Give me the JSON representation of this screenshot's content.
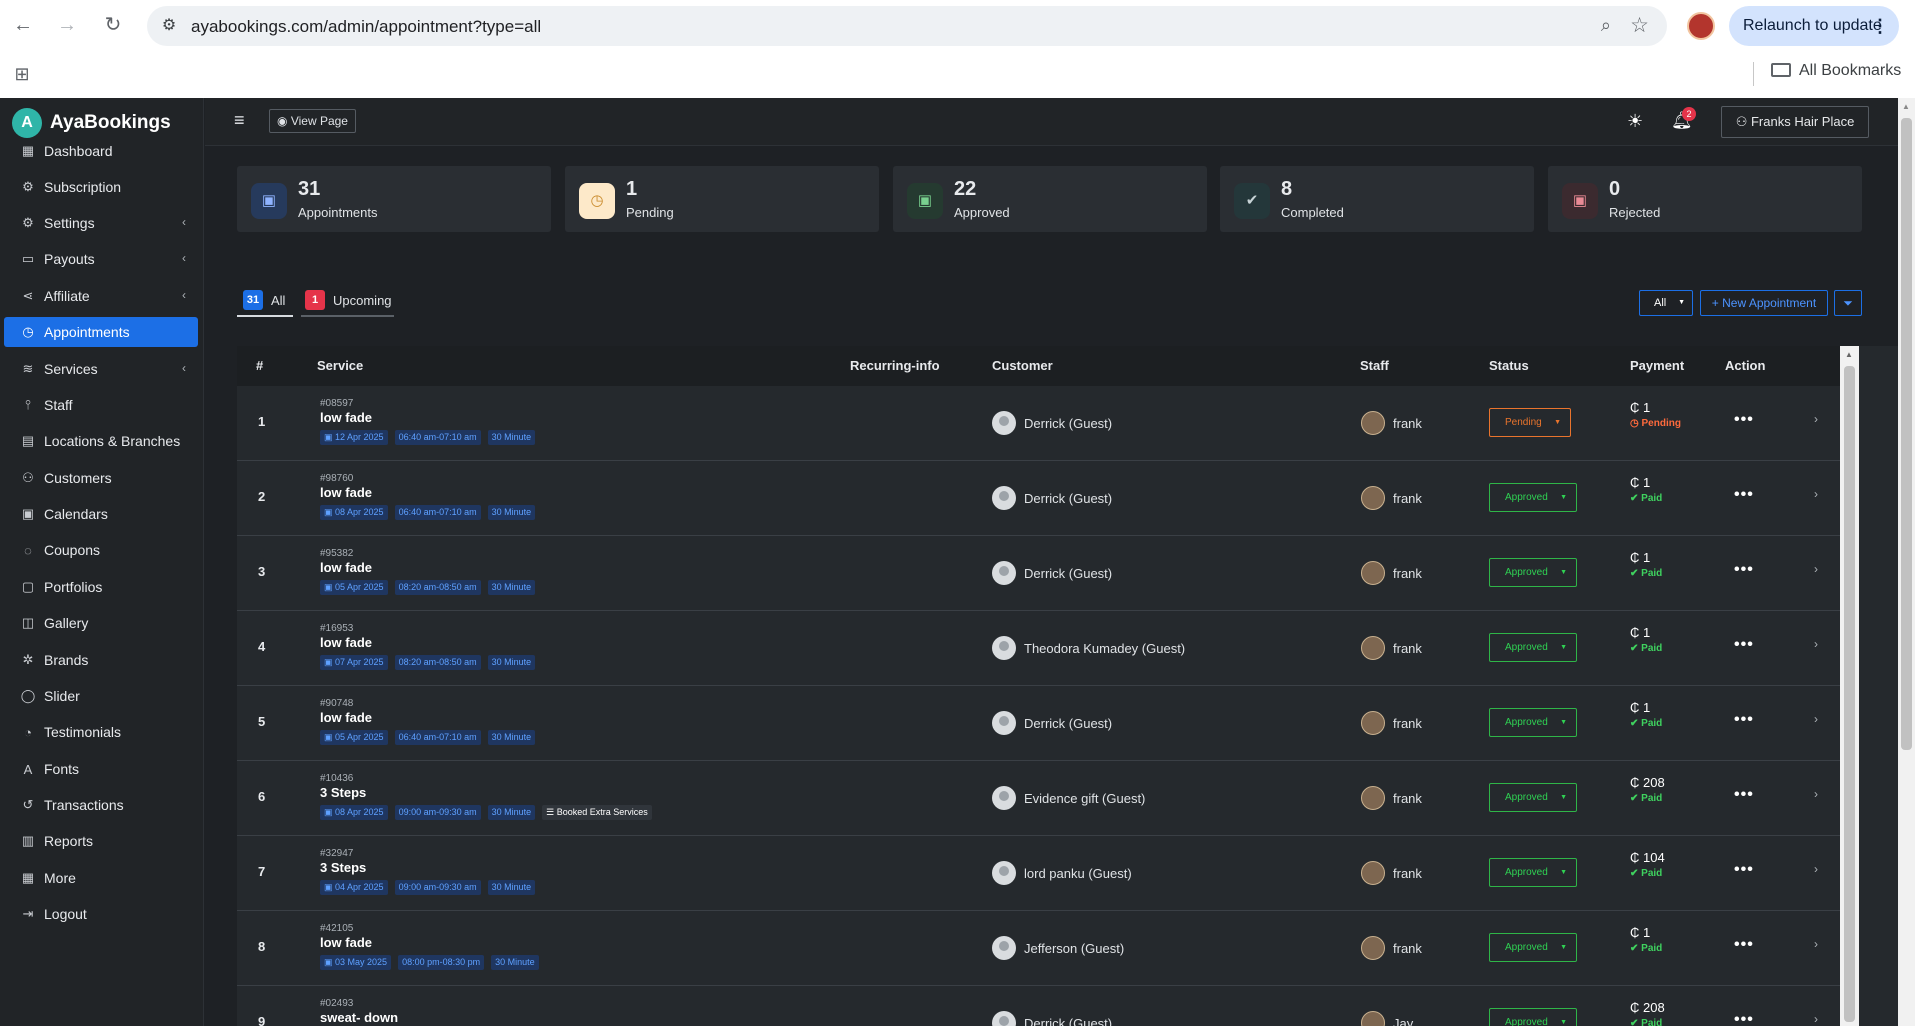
{
  "browser": {
    "url": "ayabookings.com/admin/appointment?type=all",
    "relaunch_label": "Relaunch to update",
    "bookmarks_label": "All Bookmarks"
  },
  "app": {
    "brand_name": "AyaBookings",
    "view_page_label": "View Page",
    "notification_count": "2",
    "user_label": "Franks Hair Place"
  },
  "sidebar": {
    "items": [
      {
        "label": "Dashboard",
        "icon": "grid-icon"
      },
      {
        "label": "Subscription",
        "icon": "gear-icon"
      },
      {
        "label": "Settings",
        "icon": "gear-icon"
      },
      {
        "label": "Payouts",
        "icon": "card-icon"
      },
      {
        "label": "Affiliate",
        "icon": "share-icon"
      },
      {
        "label": "Appointments",
        "icon": "clock-icon"
      },
      {
        "label": "Services",
        "icon": "layers-icon"
      },
      {
        "label": "Staff",
        "icon": "sitemap-icon"
      },
      {
        "label": "Locations & Branches",
        "icon": "building-icon"
      },
      {
        "label": "Customers",
        "icon": "users-icon"
      },
      {
        "label": "Calendars",
        "icon": "calendar-icon"
      },
      {
        "label": "Coupons",
        "icon": "coupon-icon"
      },
      {
        "label": "Portfolios",
        "icon": "portfolio-icon"
      },
      {
        "label": "Gallery",
        "icon": "gallery-icon"
      },
      {
        "label": "Brands",
        "icon": "brand-icon"
      },
      {
        "label": "Slider",
        "icon": "slider-icon"
      },
      {
        "label": "Testimonials",
        "icon": "chat-icon"
      },
      {
        "label": "Fonts",
        "icon": "font-icon"
      },
      {
        "label": "Transactions",
        "icon": "history-icon"
      },
      {
        "label": "Reports",
        "icon": "chart-icon"
      },
      {
        "label": "More",
        "icon": "table-icon"
      },
      {
        "label": "Logout",
        "icon": "logout-icon"
      }
    ]
  },
  "stats": [
    {
      "value": "31",
      "label": "Appointments"
    },
    {
      "value": "1",
      "label": "Pending"
    },
    {
      "value": "22",
      "label": "Approved"
    },
    {
      "value": "8",
      "label": "Completed"
    },
    {
      "value": "0",
      "label": "Rejected"
    }
  ],
  "tabs": [
    {
      "count": "31",
      "label": "All"
    },
    {
      "count": "1",
      "label": "Upcoming"
    }
  ],
  "toolbar": {
    "filter_value": "All",
    "new_appointment_label": "+ New Appointment"
  },
  "table": {
    "headers": [
      "#",
      "Service",
      "Recurring-info",
      "Customer",
      "Staff",
      "Status",
      "Payment",
      "Action"
    ],
    "rows": [
      {
        "num": "1",
        "code": "#08597",
        "service": "low fade",
        "date": "12 Apr 2025",
        "time": "06:40 am-07:10 am",
        "duration": "30 Minute",
        "extra": "",
        "customer": "Derrick (Guest)",
        "staff": "frank",
        "status": "Pending",
        "amount": "₵ 1",
        "pay_status": "Pending"
      },
      {
        "num": "2",
        "code": "#98760",
        "service": "low fade",
        "date": "08 Apr 2025",
        "time": "06:40 am-07:10 am",
        "duration": "30 Minute",
        "extra": "",
        "customer": "Derrick (Guest)",
        "staff": "frank",
        "status": "Approved",
        "amount": "₵ 1",
        "pay_status": "Paid"
      },
      {
        "num": "3",
        "code": "#95382",
        "service": "low fade",
        "date": "05 Apr 2025",
        "time": "08:20 am-08:50 am",
        "duration": "30 Minute",
        "extra": "",
        "customer": "Derrick (Guest)",
        "staff": "frank",
        "status": "Approved",
        "amount": "₵ 1",
        "pay_status": "Paid"
      },
      {
        "num": "4",
        "code": "#16953",
        "service": "low fade",
        "date": "07 Apr 2025",
        "time": "08:20 am-08:50 am",
        "duration": "30 Minute",
        "extra": "",
        "customer": "Theodora Kumadey (Guest)",
        "staff": "frank",
        "status": "Approved",
        "amount": "₵ 1",
        "pay_status": "Paid"
      },
      {
        "num": "5",
        "code": "#90748",
        "service": "low fade",
        "date": "05 Apr 2025",
        "time": "06:40 am-07:10 am",
        "duration": "30 Minute",
        "extra": "",
        "customer": "Derrick (Guest)",
        "staff": "frank",
        "status": "Approved",
        "amount": "₵ 1",
        "pay_status": "Paid"
      },
      {
        "num": "6",
        "code": "#10436",
        "service": "3 Steps",
        "date": "08 Apr 2025",
        "time": "09:00 am-09:30 am",
        "duration": "30 Minute",
        "extra": "Booked Extra Services",
        "customer": "Evidence gift (Guest)",
        "staff": "frank",
        "status": "Approved",
        "amount": "₵ 208",
        "pay_status": "Paid"
      },
      {
        "num": "7",
        "code": "#32947",
        "service": "3 Steps",
        "date": "04 Apr 2025",
        "time": "09:00 am-09:30 am",
        "duration": "30 Minute",
        "extra": "",
        "customer": "lord panku (Guest)",
        "staff": "frank",
        "status": "Approved",
        "amount": "₵ 104",
        "pay_status": "Paid"
      },
      {
        "num": "8",
        "code": "#42105",
        "service": "low fade",
        "date": "03 May 2025",
        "time": "08:00 pm-08:30 pm",
        "duration": "30 Minute",
        "extra": "",
        "customer": "Jefferson (Guest)",
        "staff": "frank",
        "status": "Approved",
        "amount": "₵ 1",
        "pay_status": "Paid"
      },
      {
        "num": "9",
        "code": "#02493",
        "service": "sweat- down",
        "date": "",
        "time": "",
        "duration": "",
        "extra": "",
        "customer": "Derrick (Guest)",
        "staff": "Jay",
        "status": "Approved",
        "amount": "₵ 208",
        "pay_status": "Paid"
      }
    ]
  }
}
